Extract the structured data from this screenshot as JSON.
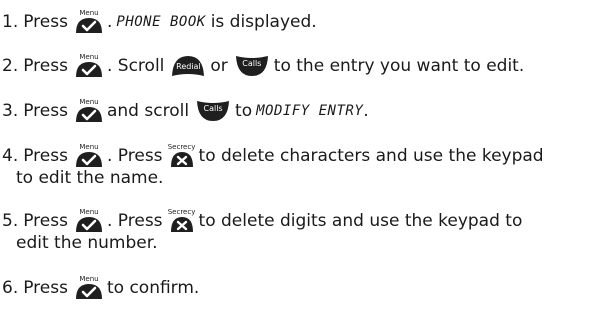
{
  "icons": {
    "menu_key": {
      "name": "menu-check-key-icon",
      "caption": "Menu"
    },
    "secrecy_key": {
      "name": "secrecy-cross-key-icon",
      "caption": "Secrecy"
    },
    "redial_key": {
      "name": "redial-scroll-key-icon",
      "caption": "Redial"
    },
    "calls_key": {
      "name": "calls-scroll-key-icon",
      "caption": "Calls"
    }
  },
  "steps": [
    {
      "number": "1.",
      "press": "Press",
      "after_key": ".",
      "display_text": "PHONE BOOK",
      "tail": "is displayed."
    },
    {
      "number": "2.",
      "press": "Press",
      "after_key": ". Scroll",
      "or": "or",
      "tail": "to the entry you want to edit."
    },
    {
      "number": "3.",
      "press": "Press",
      "middle": "and scroll",
      "to": "to",
      "display_text": "MODIFY ENTRY",
      "end": "."
    },
    {
      "number": "4.",
      "press": "Press",
      "after_key": ". Press",
      "line1_tail": "to delete characters and use the keypad",
      "line2": "to edit the name."
    },
    {
      "number": "5.",
      "press": "Press",
      "after_key": ". Press",
      "line1_tail": "to delete digits and use the keypad to",
      "line2": "edit the number."
    },
    {
      "number": "6.",
      "press": "Press",
      "tail": "to confirm."
    }
  ]
}
